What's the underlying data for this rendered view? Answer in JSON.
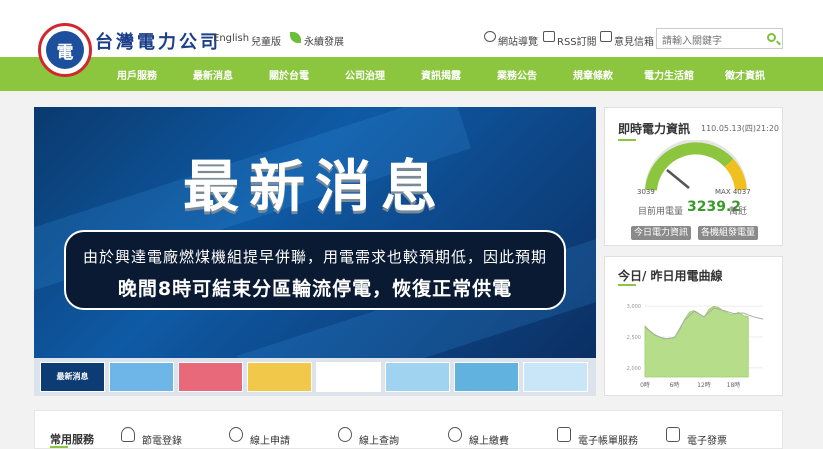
{
  "header": {
    "logo_glyph": "電",
    "brand": "台灣電力公司",
    "links": {
      "english": "English",
      "kids": "兒童版",
      "sustain": "永續發展"
    },
    "utility": {
      "sitemap": "網站導覽",
      "rss": "RSS訂閱",
      "feedback": "意見信箱"
    },
    "search": {
      "placeholder": "請輸入關鍵字"
    }
  },
  "nav": {
    "items": [
      {
        "label": "用戶服務"
      },
      {
        "label": "最新消息"
      },
      {
        "label": "關於台電"
      },
      {
        "label": "公司治理"
      },
      {
        "label": "資訊揭露"
      },
      {
        "label": "業務公告"
      },
      {
        "label": "規章條款"
      },
      {
        "label": "電力生活館"
      },
      {
        "label": "徵才資訊"
      }
    ]
  },
  "banner": {
    "title": "最新消息",
    "line1": "由於興達電廠燃煤機組提早併聯，用電需求也較預期低，因此預期",
    "line2": "晚間8時可結束分區輪流停電，恢復正常供電"
  },
  "thumbs": [
    {
      "caption": "最新消息",
      "color": "#0d3b73"
    },
    {
      "caption": "",
      "color": "#6fb6e8"
    },
    {
      "caption": "",
      "color": "#e86a7a"
    },
    {
      "caption": "",
      "color": "#f2c84b"
    },
    {
      "caption": "",
      "color": "#ffffff"
    },
    {
      "caption": "",
      "color": "#9fd3ef"
    },
    {
      "caption": "",
      "color": "#62b2e0"
    },
    {
      "caption": "",
      "color": "#c8e6f7"
    },
    {
      "caption": "",
      "color": "#3a8fd0"
    }
  ],
  "power": {
    "title": "即時電力資訊",
    "timestamp": "110.05.13(四)21:20",
    "gauge_min": "3039",
    "gauge_max": "MAX 4037",
    "usage_label": "目前用電量",
    "usage_value": "3239.2",
    "usage_unit": "萬瓩",
    "btn_today": "今日電力資訊",
    "btn_units": "各機組發電量"
  },
  "curve": {
    "title": "今日/ 昨日用電曲線",
    "chart_data": {
      "type": "area",
      "x_ticks": [
        "0時",
        "6時",
        "12時",
        "18時"
      ],
      "y_ticks": [
        "3,000",
        "2,500",
        "2,000"
      ],
      "xlim": [
        0,
        24
      ],
      "ylim": [
        1850,
        3150
      ],
      "series": [
        {
          "values_x": [
            0,
            1,
            2,
            3,
            4,
            5,
            6,
            7,
            8,
            9,
            10,
            11,
            12,
            13,
            14,
            15,
            16,
            17,
            18,
            19,
            20,
            21
          ],
          "values": [
            2680,
            2600,
            2540,
            2500,
            2480,
            2470,
            2500,
            2600,
            2780,
            2900,
            2930,
            2880,
            2820,
            2950,
            3000,
            2980,
            2920,
            2880,
            2860,
            2900,
            2850,
            2830
          ],
          "color": "#b6dd8a"
        },
        {
          "values_x": [
            0,
            2,
            4,
            6,
            8,
            10,
            12,
            14,
            16,
            18,
            20,
            22,
            24
          ],
          "values": [
            2660,
            2530,
            2470,
            2490,
            2770,
            2920,
            2830,
            2970,
            2930,
            2880,
            2890,
            2830,
            2790
          ],
          "color": "#aaaaaa"
        }
      ]
    }
  },
  "services": {
    "title": "常用服務",
    "items": [
      {
        "label": "節電登錄"
      },
      {
        "label": "線上申請"
      },
      {
        "label": "線上查詢"
      },
      {
        "label": "線上繳費"
      },
      {
        "label": "電子帳單服務"
      },
      {
        "label": "電子發票"
      }
    ]
  },
  "colors": {
    "accent": "#8cc63f",
    "brand_blue": "#1c3f8a",
    "logo_red": "#d0282e"
  }
}
